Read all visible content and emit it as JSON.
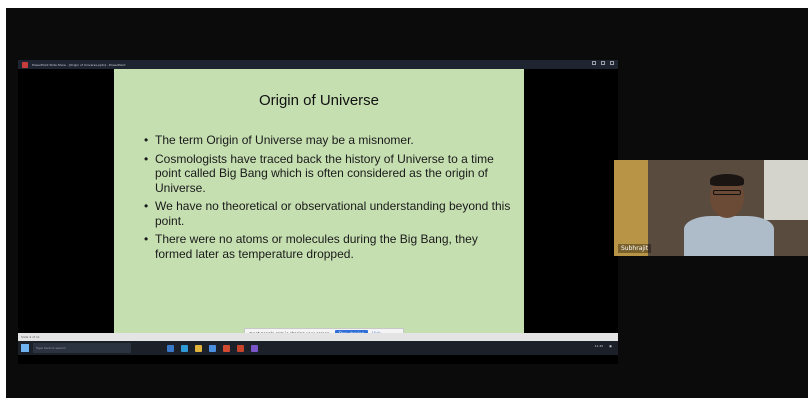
{
  "window": {
    "title": "PowerPoint Slide Show - [Origin of Universe.pptx] - PowerPoint"
  },
  "slide": {
    "title": "Origin of Universe",
    "bullets": [
      "The term Origin of Universe may be a misnomer.",
      "Cosmologists have traced back the history of Universe to a time point called Big Bang which is often considered as the origin of Universe.",
      "We have no theoretical or observational understanding beyond this point.",
      "There were no atoms or molecules during the Big Bang, they formed later as temperature dropped."
    ],
    "bullet_glyph": "•"
  },
  "share_banner": {
    "message": "meet.google.com is sharing your screen.",
    "stop_label": "Stop sharing",
    "hide_label": "Hide"
  },
  "ppt_status": "Slide 4 of 11",
  "taskbar": {
    "search_placeholder": "Type here to search",
    "time": "11:45"
  },
  "participant": {
    "name": "Subhrajit"
  },
  "colors": {
    "slide_bg": "#c5dfb1",
    "frame_bg": "#0b0b0b"
  }
}
